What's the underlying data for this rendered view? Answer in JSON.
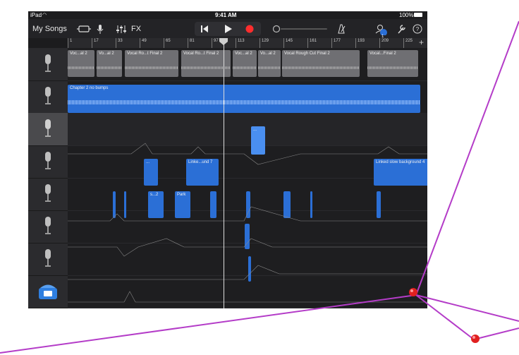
{
  "statusbar": {
    "device": "iPad",
    "time": "9:41 AM",
    "battery": "100%"
  },
  "toolbar": {
    "my_songs": "My Songs",
    "fx": "FX",
    "notifications_badge": "1"
  },
  "ruler": {
    "bars": [
      "1",
      "17",
      "33",
      "49",
      "65",
      "81",
      "97",
      "113",
      "129",
      "145",
      "161",
      "177",
      "193",
      "209",
      "225"
    ]
  },
  "tracks": [
    {
      "icon": "microphone-icon",
      "regions": [
        "Voc...al 2",
        "Vo...al 2",
        "Vocal Ro...t Final 2",
        "Vocal Ro...t Final 2",
        "Voc...al 2",
        "Vo...al 2",
        "Vocal Rough Cut Final 2",
        "Vocal...Final 2"
      ]
    },
    {
      "icon": "microphone-icon",
      "regions": [
        "Chapter 2 no bumps"
      ]
    },
    {
      "icon": "microphone-icon",
      "regions": [
        "..."
      ]
    },
    {
      "icon": "microphone-icon",
      "regions": [
        "...",
        "Linke...und 7",
        "Linked slow background 4"
      ]
    },
    {
      "icon": "microphone-icon",
      "regions": [
        "s...2",
        "Park"
      ]
    },
    {
      "icon": "microphone-icon",
      "regions": []
    },
    {
      "icon": "microphone-icon",
      "regions": []
    },
    {
      "icon": "telephone-icon",
      "regions": []
    }
  ],
  "colors": {
    "accent": "#2b6fd6",
    "record": "#ff2d2d",
    "cable": "#b43cc8",
    "pin": "#e02020"
  }
}
